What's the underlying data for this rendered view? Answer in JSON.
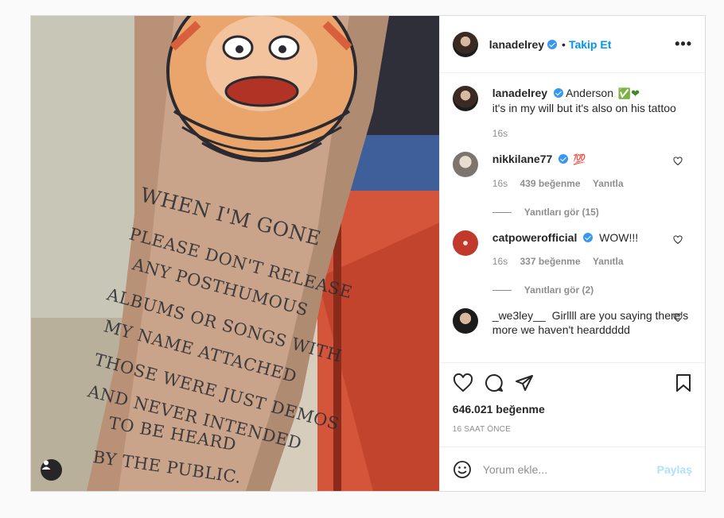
{
  "post": {
    "author": "lanadelrey",
    "follow_label": "Takip Et",
    "separator": "•",
    "more_label": "•••",
    "tattoo_lines": [
      "WHEN I'M GONE",
      "PLEASE DON'T RELEASE",
      "ANY POSTHUMOUS",
      "ALBUMS OR SONGS WITH",
      "MY NAME ATTACHED",
      "THOSE WERE JUST DEMOS",
      "AND NEVER INTENDED",
      "TO BE HEARD",
      "BY THE PUBLIC."
    ]
  },
  "caption": {
    "username": "lanadelrey",
    "text_line1": "Anderson",
    "emoji": "✅❤",
    "text_line2": "it's in my will but it's also on his tattoo",
    "time": "16s"
  },
  "comments": [
    {
      "username": "nikkilane77",
      "text": "",
      "emoji": "💯",
      "time": "16s",
      "likes": "439 beğenme",
      "reply_label": "Yanıtla",
      "view_replies": "Yanıtları gör (15)"
    },
    {
      "username": "catpowerofficial",
      "text": "WOW!!!",
      "emoji": "",
      "time": "16s",
      "likes": "337 beğenme",
      "reply_label": "Yanıtla",
      "view_replies": "Yanıtları gör (2)"
    },
    {
      "username": "_we3ley__",
      "text": "Girllll are you saying there's more we haven't hearddddd",
      "emoji": ""
    }
  ],
  "actions": {
    "likes": "646.021 beğenme",
    "timestamp": "16 SAAT ÖNCE"
  },
  "add_comment": {
    "placeholder": "Yorum ekle...",
    "post_label": "Paylaş"
  },
  "colors": {
    "accent": "#0095f6",
    "verified": "#3897f0",
    "post_disabled": "#b2dffc",
    "muted": "#8e8e8e"
  }
}
